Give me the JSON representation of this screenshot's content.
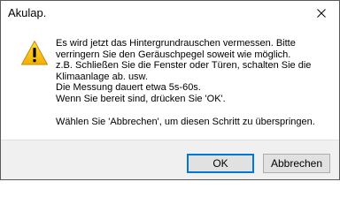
{
  "window": {
    "title": "Akulap.",
    "close_icon": "close-icon"
  },
  "message": {
    "icon": "warning-icon",
    "icon_color": "#f5c518",
    "lines": [
      "Es wird jetzt das Hintergrundrauschen vermessen. Bitte",
      "verringern Sie den Geräuschpegel soweit wie möglich.",
      "z.B. Schließen Sie die Fenster oder Türen, schalten Sie die",
      "Klimaanlage ab. usw.",
      "Die Messung dauert etwa 5s-60s.",
      "Wenn Sie bereit sind, drücken Sie 'OK'."
    ],
    "skip_hint": "Wählen Sie 'Abbrechen', um diesen Schritt zu überspringen."
  },
  "buttons": {
    "ok_label": "OK",
    "cancel_label": "Abbrechen",
    "default_border_color": "#0078d7"
  }
}
